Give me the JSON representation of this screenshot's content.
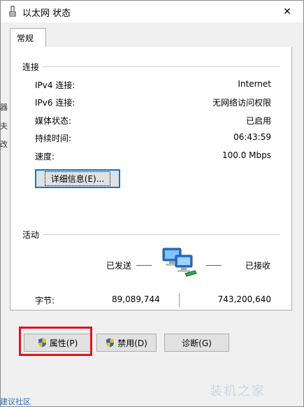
{
  "window": {
    "title": "以太网 状态",
    "close_glyph": "✕"
  },
  "tabs": [
    {
      "label": "常规"
    }
  ],
  "connection": {
    "group_title": "连接",
    "rows": [
      {
        "label": "IPv4 连接:",
        "value": "Internet"
      },
      {
        "label": "IPv6 连接:",
        "value": "无网络访问权限"
      },
      {
        "label": "媒体状态:",
        "value": "已启用"
      },
      {
        "label": "持续时间:",
        "value": "06:43:59"
      },
      {
        "label": "速度:",
        "value": "100.0 Mbps"
      }
    ],
    "details_button": "详细信息(E)..."
  },
  "activity": {
    "group_title": "活动",
    "sent_label": "已发送",
    "received_label": "已接收",
    "bytes_label": "字节:",
    "bytes_sent": "89,089,744",
    "bytes_received": "743,200,640"
  },
  "buttons": {
    "properties": "属性(P)",
    "disable": "禁用(D)",
    "diagnose": "诊断(G)"
  },
  "icons": {
    "title_icon": "ethernet-icon",
    "network_icon": "network-computers-icon",
    "shield_icon": "uac-shield-icon"
  },
  "colors": {
    "focus_border": "#0078d7",
    "highlight": "#e0141b"
  },
  "background": {
    "left_fragments": [
      "器",
      "夫",
      "改"
    ],
    "bottom_link": "建议社区",
    "watermark": "装机之家"
  }
}
